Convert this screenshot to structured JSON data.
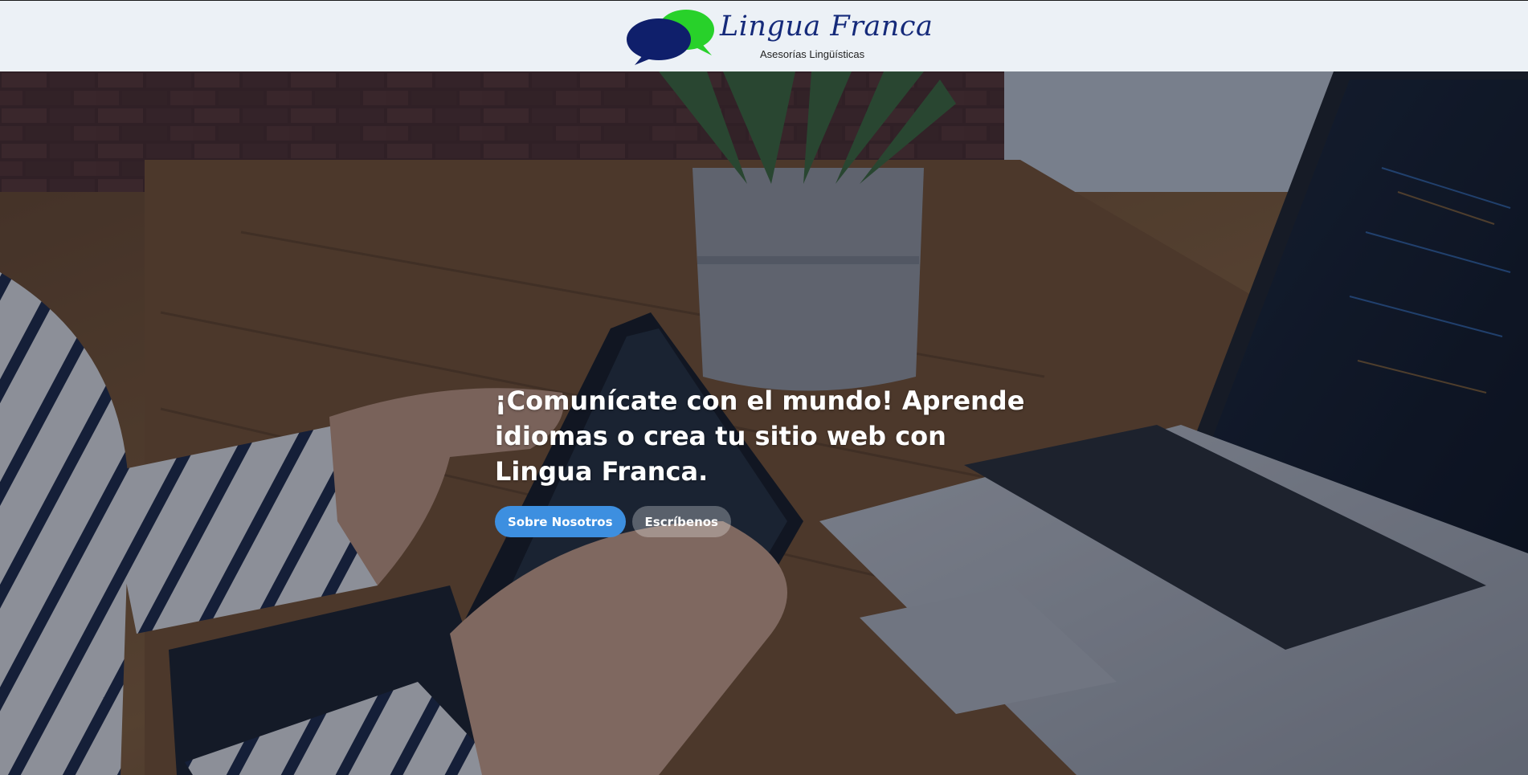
{
  "header": {
    "logo_title": "Lingua Franca",
    "logo_subtitle": "Asesorías Lingüísticas",
    "colors": {
      "logo_dark_bubble": "#0f1f6b",
      "logo_light_bubble": "#28d12a",
      "logo_text": "#152a7a"
    }
  },
  "hero": {
    "heading": "¡Comunícate con el mundo! Aprende idiomas o crea tu sitio web con Lingua Franca.",
    "primary_button_label": "Sobre Nosotros",
    "secondary_button_label": "Escríbenos",
    "background_image": "desk-laptop-tablet-photo",
    "colors": {
      "primary_button": "#3d8fe0",
      "secondary_button": "rgba(255,255,255,0.28)"
    }
  }
}
